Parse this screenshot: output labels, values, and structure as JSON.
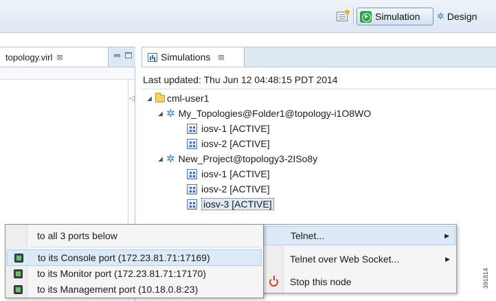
{
  "toolbar": {
    "new_icon": "new-window-icon",
    "perspectives": [
      {
        "label": "Simulation",
        "icon": "play-circle-icon",
        "active": true
      },
      {
        "label": "Design",
        "icon": "topology-icon",
        "active": false
      }
    ]
  },
  "editor": {
    "tab_label": "topology.virl",
    "close_glyph": "⊠"
  },
  "simulations_view": {
    "tab_label": "Simulations",
    "close_glyph": "⊠",
    "last_updated": "Last updated: Thu Jun 12 04:48:15 PDT 2014",
    "tree": {
      "user": "cml-user1",
      "topologies": [
        {
          "label": "My_Topologies@Folder1@topology-i1O8WO",
          "nodes": [
            "iosv-1 [ACTIVE]",
            "iosv-2 [ACTIVE]"
          ]
        },
        {
          "label": "New_Project@topology3-2ISo8y",
          "nodes": [
            "iosv-1 [ACTIVE]",
            "iosv-2 [ACTIVE]",
            "iosv-3 [ACTIVE]"
          ]
        }
      ]
    }
  },
  "context_menu": {
    "items": [
      {
        "label": "Telnet...",
        "submenu": true,
        "highlighted": true
      },
      {
        "label": "Telnet over Web Socket...",
        "submenu": true,
        "highlighted": false
      },
      {
        "label": "Stop this node",
        "icon": "power-icon",
        "highlighted": false
      }
    ]
  },
  "telnet_submenu": {
    "items": [
      {
        "label": "to all 3 ports below"
      },
      {
        "label": "to its Console port (172.23.81.71:17169)",
        "icon": "terminal-icon",
        "highlighted": true
      },
      {
        "label": "to its Monitor port (172.23.81.71:17170)",
        "icon": "terminal-icon",
        "highlighted": false
      },
      {
        "label": "to its Management port (10.18.0.8:23)",
        "icon": "terminal-icon",
        "highlighted": false
      }
    ]
  },
  "figure_id": "391814",
  "colors": {
    "toolbar_bg": "#dde7f2",
    "highlight": "#dce9f7",
    "topology_icon": "#2d7fc9",
    "active_perspective": "#2ea44a",
    "stop_icon": "#d9401d"
  }
}
